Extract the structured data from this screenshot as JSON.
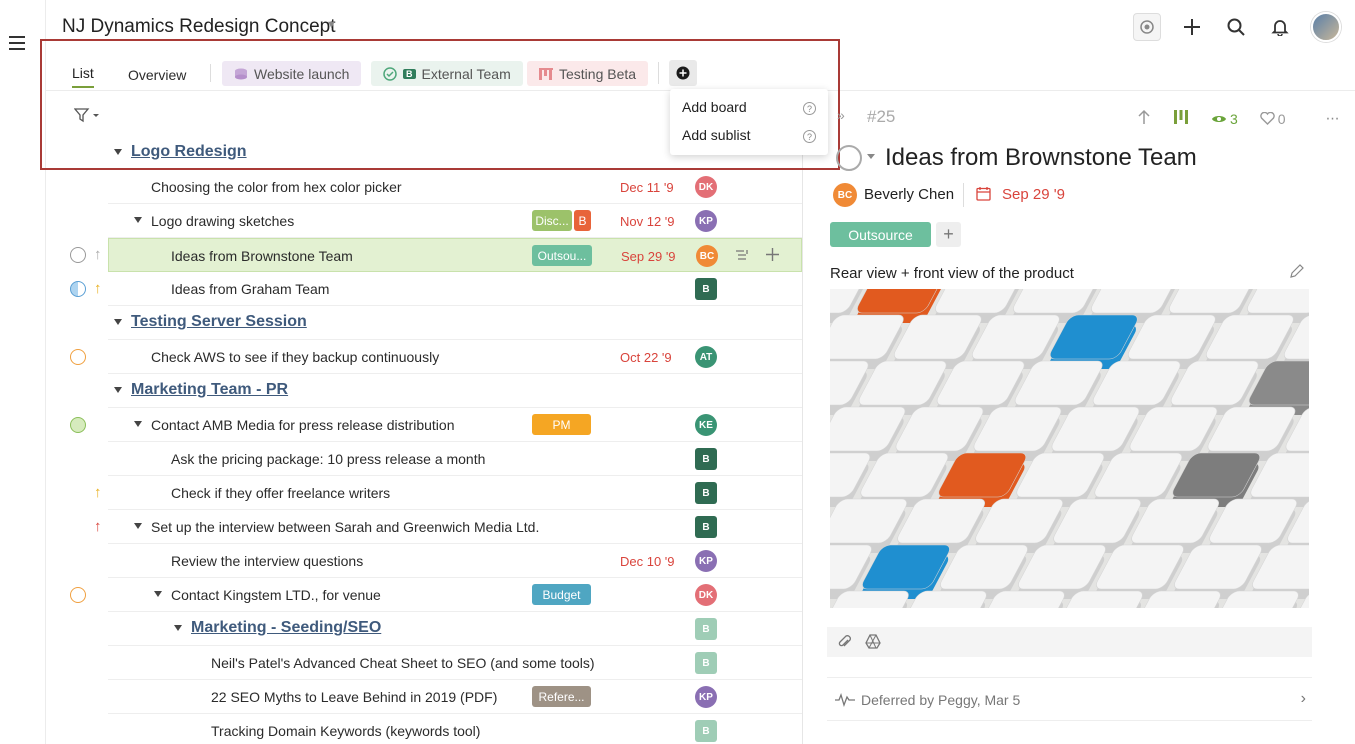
{
  "header": {
    "project_title": "NJ Dynamics Redesign Concept"
  },
  "tabs": {
    "list": "List",
    "overview": "Overview",
    "website_launch": "Website launch",
    "external_team": "External Team",
    "external_badge": "B",
    "testing_beta": "Testing Beta"
  },
  "dropdown": {
    "add_board": "Add board",
    "add_sublist": "Add sublist",
    "help": "?"
  },
  "colors": {
    "accent_green": "#7a9f3a",
    "date_red": "#d9443c",
    "section_blue": "#3f5a7c",
    "highlight_frame": "#a93a36"
  },
  "rows": {
    "r0": {
      "title": "Logo Redesign"
    },
    "r1": {
      "title": "Choosing the color from hex color picker",
      "date": "Dec 11 '9",
      "avatar": "DK"
    },
    "r2": {
      "title": "Logo drawing sketches",
      "tag": "Disc...",
      "tag2": "B",
      "date": "Nov 12 '9",
      "avatar": "KP"
    },
    "r3": {
      "title": "Ideas from Brownstone Team",
      "tag": "Outsou...",
      "date": "Sep 29 '9",
      "avatar": "BC"
    },
    "r4": {
      "title": "Ideas from Graham Team",
      "avatar": "B"
    },
    "r5": {
      "title": "Testing Server Session"
    },
    "r6": {
      "title": "Check AWS to see if they backup continuously",
      "date": "Oct 22 '9",
      "avatar": "AT"
    },
    "r7": {
      "title": "Marketing Team - PR"
    },
    "r8": {
      "title": "Contact AMB Media for press release distribution",
      "tag": "PM",
      "avatar": "KE"
    },
    "r9": {
      "title": "Ask the pricing package: 10 press release a month",
      "avatar": "B"
    },
    "r10": {
      "title": "Check if they offer freelance writers",
      "avatar": "B"
    },
    "r11": {
      "title": "Set up the interview between Sarah and Greenwich Media Ltd.",
      "avatar": "B"
    },
    "r12": {
      "title": "Review the interview questions",
      "date": "Dec 10 '9",
      "avatar": "KP"
    },
    "r13": {
      "title": "Contact Kingstem LTD., for venue",
      "tag": "Budget",
      "avatar": "DK"
    },
    "r14": {
      "title": "Marketing - Seeding/SEO",
      "avatar": "B"
    },
    "r15": {
      "title": "Neil's Patel's Advanced Cheat Sheet to SEO (and some tools)",
      "avatar": "B"
    },
    "r16": {
      "title": "22 SEO Myths to Leave Behind in 2019 (PDF)",
      "tag": "Refere...",
      "avatar": "KP"
    },
    "r17": {
      "title": "Tracking Domain Keywords (keywords tool)",
      "avatar": "B"
    }
  },
  "detail": {
    "id": "#25",
    "watchers": "3",
    "likes": "0",
    "title": "Ideas from Brownstone Team",
    "owner_initials": "BC",
    "owner": "Beverly Chen",
    "due": "Sep 29 '9",
    "tag": "Outsource",
    "tag_add": "+",
    "note": "Rear view + front view of the product",
    "activity": "Deferred by Peggy, Mar 5"
  }
}
